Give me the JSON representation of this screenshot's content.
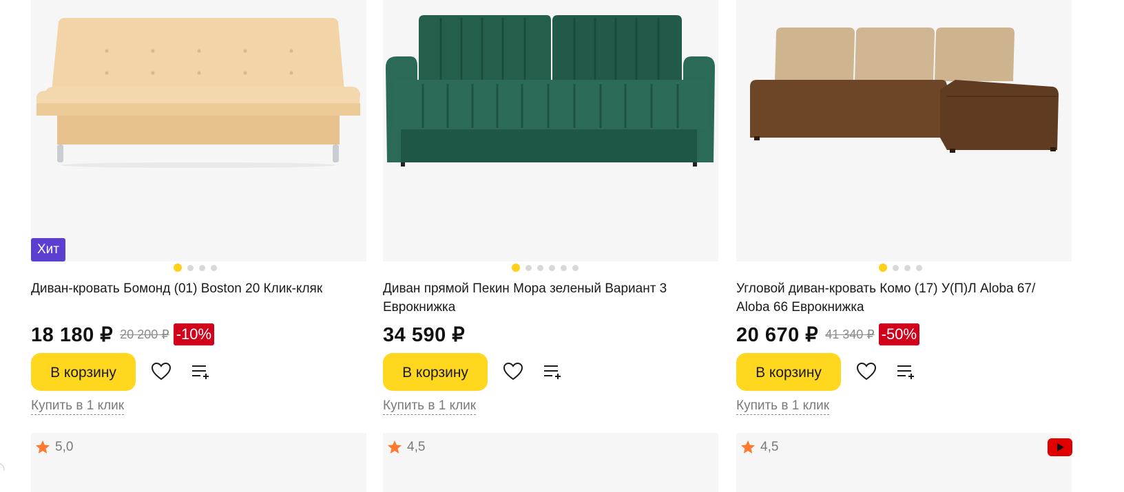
{
  "products": [
    {
      "badge": "Хит",
      "title": "Диван-кровать Бомонд (01) Boston 20 Клик-кляк",
      "price": "18 180 ₽",
      "old_price": "20 200 ₽",
      "discount": "-10%",
      "cart_label": "В корзину",
      "quick_buy": "Купить в 1 клик",
      "rating": "5,0",
      "image_count": 4,
      "sofa_color": "#f1d2a2"
    },
    {
      "title": "Диван прямой Пекин Мора зеленый Вариант 3 Еврокнижка",
      "price": "34 590 ₽",
      "cart_label": "В корзину",
      "quick_buy": "Купить в 1 клик",
      "rating": "4,5",
      "image_count": 6,
      "sofa_color": "#1f5a48"
    },
    {
      "title": "Угловой диван-кровать Комо (17) У(П)Л Aloba 67/ Aloba 66 Еврокнижка",
      "price": "20 670 ₽",
      "old_price": "41 340 ₽",
      "discount": "-50%",
      "cart_label": "В корзину",
      "quick_buy": "Купить в 1 клик",
      "rating": "4,5",
      "image_count": 4,
      "sofa_color": "#6b4324",
      "has_video": true
    }
  ],
  "colors": {
    "cart_button": "#ffd71e",
    "discount_badge": "#d0021b",
    "hit_badge": "#5b3fd1",
    "active_dot": "#ffcf1a",
    "star": "#ff7a2f"
  },
  "icons": {
    "favorite": "heart-icon",
    "compare": "compare-list-icon",
    "rating": "star-icon",
    "video": "youtube-icon"
  }
}
